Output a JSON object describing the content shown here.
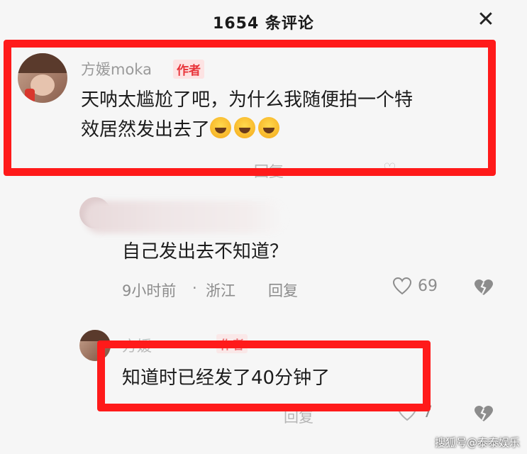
{
  "header": {
    "title": "1654 条评论",
    "close_icon": "close-icon"
  },
  "comments": [
    {
      "author": "方媛moka",
      "badge": "作者",
      "text_line1": "天呐太尴尬了吧，为什么我随便拍一个特",
      "text_line2": "效居然发出去了",
      "emojis": [
        "laugh-cry-emoji",
        "laugh-cry-emoji",
        "laugh-cry-emoji"
      ],
      "reply_label": "回复"
    },
    {
      "text": "自己发出去不知道？",
      "time": "9小时前",
      "location": "浙江",
      "reply_label": "回复",
      "likes": "69"
    },
    {
      "badge": "作者",
      "text": "知道时已经发了40分钟了",
      "reply_label": "回复",
      "likes": "7"
    }
  ],
  "watermark": "搜狐号@泰泰娱乐",
  "colors": {
    "highlight": "#ff1a1a",
    "badge_text": "#e8343a",
    "badge_bg": "#fde3e3"
  }
}
